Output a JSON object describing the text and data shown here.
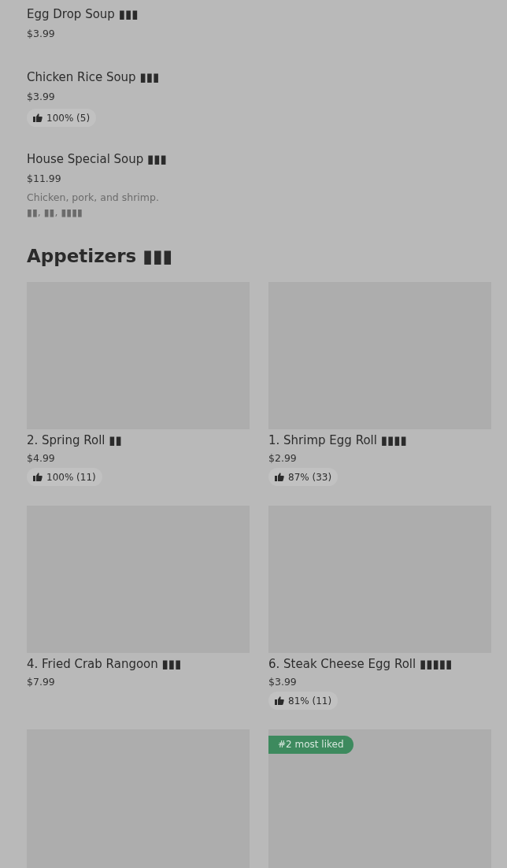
{
  "soups": [
    {
      "name": "Egg Drop Soup ▮▮▮",
      "price": "$3.99"
    },
    {
      "name": "Chicken Rice Soup ▮▮▮",
      "price": "$3.99",
      "rating": "100% (5)"
    },
    {
      "name": "House Special Soup ▮▮▮",
      "price": "$11.99",
      "description": [
        "Chicken, pork, and shrimp.",
        "▮▮, ▮▮, ▮▮▮▮"
      ]
    }
  ],
  "appetizers": {
    "title": "Appetizers ▮▮▮",
    "items": [
      {
        "kind": "picture",
        "name": "2. Spring Roll ▮▮",
        "price": "$4.99",
        "rating": "100% (11)"
      },
      {
        "kind": "picture",
        "name": "1. Shrimp Egg Roll ▮▮▮▮",
        "price": "$2.99",
        "rating": "87% (33)"
      },
      {
        "kind": "picture",
        "name": "4. Fried Crab Rangoon ▮▮▮",
        "price": "$7.99"
      },
      {
        "kind": "picture",
        "name": "6. Steak Cheese Egg Roll ▮▮▮▮▮",
        "price": "$3.99",
        "rating": "81% (11)"
      },
      {
        "kind": "picture"
      },
      {
        "kind": "picture",
        "badge": "#2 most liked"
      }
    ]
  }
}
